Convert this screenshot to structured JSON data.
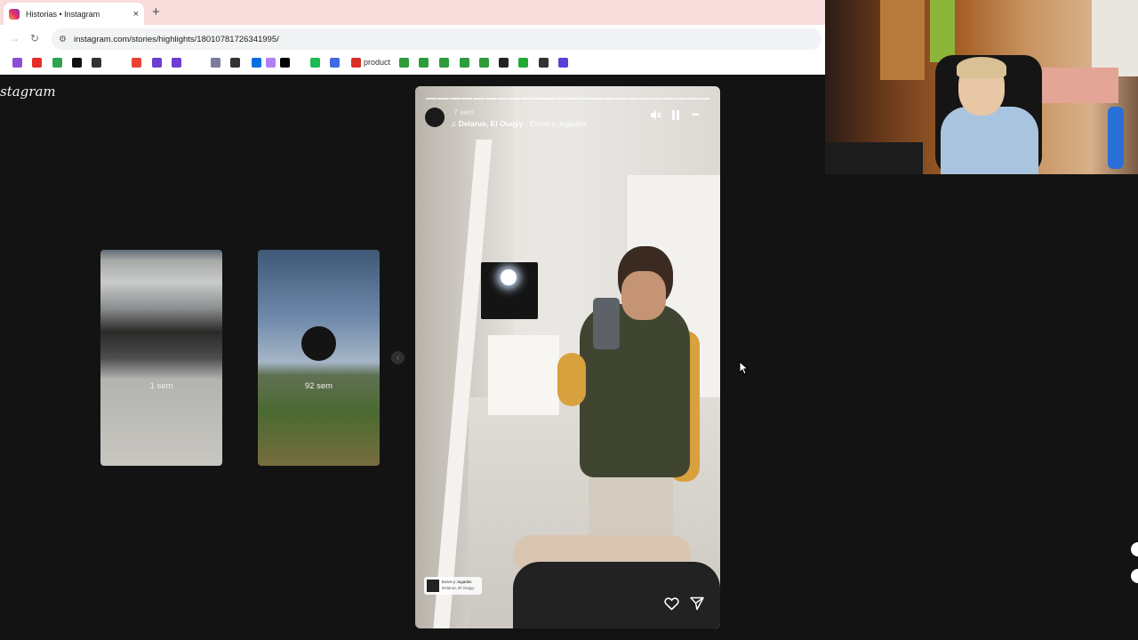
{
  "browser": {
    "tab_title": "Historias • Instagram",
    "tab_close": "×",
    "new_tab": "+",
    "back": "→",
    "reload": "↻",
    "url": "instagram.com/stories/highlights/18010781726341995/",
    "bookmark_label": "product",
    "bookmark_colors": [
      "#8a4fd6",
      "#e52d27",
      "#2ea34b",
      "#111111",
      "#333333",
      "#ea4335",
      "#6c3fd1",
      "#6c3fd1",
      "#7c7c9c",
      "#333333",
      "#0070e0",
      "#b081f0",
      "#000000",
      "#1db954",
      "#4169e1",
      "#d93025",
      "#2e9b3c",
      "#2e9b3c",
      "#2e9b3c",
      "#2e9b3c",
      "#2e9b3c",
      "#222222",
      "#22aa33",
      "#333333",
      "#5b3fd6"
    ]
  },
  "instagram": {
    "logo": "stagram",
    "thumbnails": [
      {
        "age": "1 sem"
      },
      {
        "age": "92 sem"
      }
    ],
    "prev_arrow": "‹"
  },
  "story": {
    "time": "7 sem",
    "song_title": "Delarue, El Ouqyy",
    "song_sep": " · ",
    "song_name": "Euros y Jugadas",
    "more": "•••",
    "sticker_title": "Euros y Jugadas",
    "sticker_artist": "Delarue, El Ouqyy",
    "segments": 24
  }
}
